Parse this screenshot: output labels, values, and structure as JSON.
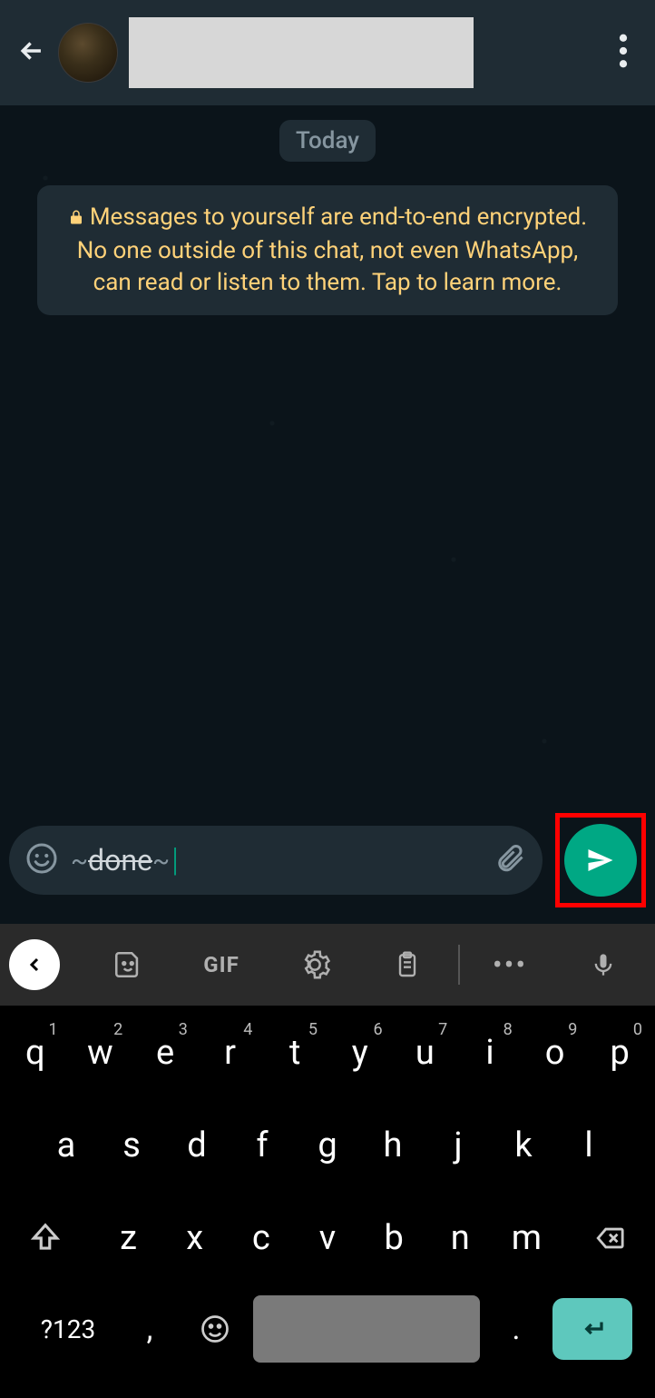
{
  "header": {
    "contact_name": ""
  },
  "chat": {
    "date_label": "Today",
    "encryption_notice": "Messages to yourself are end-to-end encrypted. No one outside of this chat, not even WhatsApp, can read or listen to them. Tap to learn more."
  },
  "composer": {
    "tilde_prefix": "~",
    "typed_text": "done",
    "tilde_suffix": "~"
  },
  "keyboard_toolbar": {
    "gif_label": "GIF"
  },
  "keyboard": {
    "row1": [
      {
        "k": "q",
        "n": "1"
      },
      {
        "k": "w",
        "n": "2"
      },
      {
        "k": "e",
        "n": "3"
      },
      {
        "k": "r",
        "n": "4"
      },
      {
        "k": "t",
        "n": "5"
      },
      {
        "k": "y",
        "n": "6"
      },
      {
        "k": "u",
        "n": "7"
      },
      {
        "k": "i",
        "n": "8"
      },
      {
        "k": "o",
        "n": "9"
      },
      {
        "k": "p",
        "n": "0"
      }
    ],
    "row2": [
      "a",
      "s",
      "d",
      "f",
      "g",
      "h",
      "j",
      "k",
      "l"
    ],
    "row3": [
      "z",
      "x",
      "c",
      "v",
      "b",
      "n",
      "m"
    ],
    "symbols_label": "?123",
    "comma": ",",
    "period": "."
  }
}
